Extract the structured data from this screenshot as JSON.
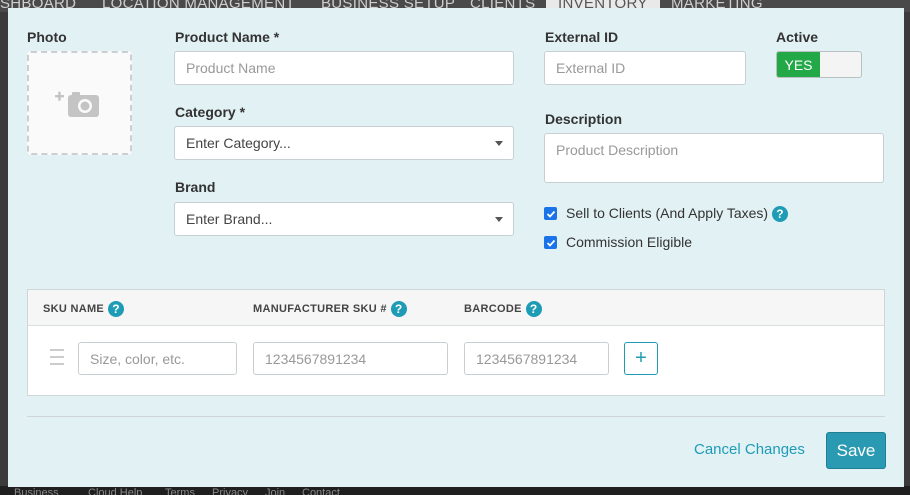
{
  "background_nav": {
    "items": [
      "SHBOARD",
      "LOCATION MANAGEMENT",
      "BUSINESS SETUP",
      "CLIENTS",
      "INVENTORY",
      "MARKETING"
    ]
  },
  "background_footer": {
    "items": [
      "Business",
      "Cloud Help",
      "Terms",
      "Privacy",
      "Join",
      "Contact"
    ]
  },
  "form": {
    "photo_label": "Photo",
    "product_name_label": "Product Name *",
    "product_name_placeholder": "Product Name",
    "category_label": "Category *",
    "category_value": "Enter Category...",
    "brand_label": "Brand",
    "brand_value": "Enter Brand...",
    "external_id_label": "External ID",
    "external_id_placeholder": "External ID",
    "active_label": "Active",
    "active_toggle": "YES",
    "description_label": "Description",
    "description_placeholder": "Product Description",
    "sell_to_clients_label": "Sell to Clients (And Apply Taxes)",
    "sell_to_clients_checked": true,
    "commission_label": "Commission Eligible",
    "commission_checked": true
  },
  "sku_table": {
    "headers": [
      "SKU NAME",
      "MANUFACTURER SKU #",
      "BARCODE"
    ],
    "help_glyph": "?",
    "row": {
      "sku_name_placeholder": "Size, color, etc.",
      "manufacturer_sku_placeholder": "1234567891234",
      "barcode_placeholder": "1234567891234"
    },
    "add_glyph": "+"
  },
  "footer": {
    "cancel_label": "Cancel Changes",
    "save_label": "Save"
  },
  "colors": {
    "modal_bg": "#e2f1f4",
    "accent": "#1e9cb6",
    "toggle_on": "#22a847",
    "save_button": "#2a9ab2"
  }
}
